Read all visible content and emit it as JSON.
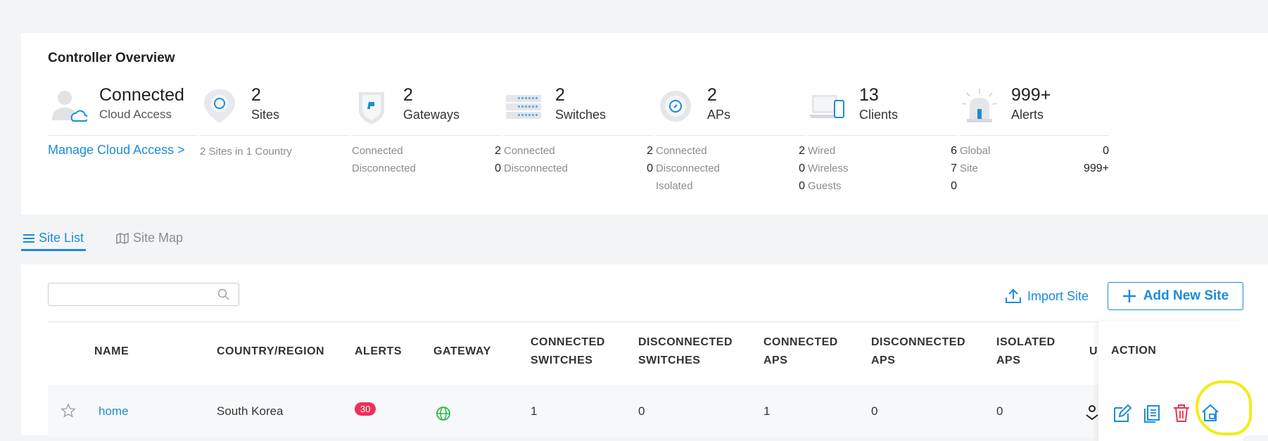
{
  "overview": {
    "title": "Controller Overview",
    "cloud": {
      "status": "Connected",
      "label": "Cloud Access",
      "link": "Manage Cloud Access >"
    },
    "sites": {
      "count": "2",
      "label": "Sites",
      "sub": "2 Sites in 1 Country"
    },
    "gateways": {
      "count": "2",
      "label": "Gateways",
      "rows": [
        {
          "k": "Connected",
          "v": "2"
        },
        {
          "k": "Disconnected",
          "v": "0"
        }
      ]
    },
    "switches": {
      "count": "2",
      "label": "Switches",
      "rows": [
        {
          "k": "Connected",
          "v": "2"
        },
        {
          "k": "Disconnected",
          "v": "0"
        }
      ]
    },
    "aps": {
      "count": "2",
      "label": "APs",
      "rows": [
        {
          "k": "Connected",
          "v": "2"
        },
        {
          "k": "Disconnected",
          "v": "0"
        },
        {
          "k": "Isolated",
          "v": "0"
        }
      ]
    },
    "clients": {
      "count": "13",
      "label": "Clients",
      "rows": [
        {
          "k": "Wired",
          "v": "6"
        },
        {
          "k": "Wireless",
          "v": "7"
        },
        {
          "k": "Guests",
          "v": "0"
        }
      ]
    },
    "alerts": {
      "count": "999+",
      "label": "Alerts",
      "rows": [
        {
          "k": "Global",
          "v": "0"
        },
        {
          "k": "Site",
          "v": "999+"
        }
      ]
    }
  },
  "tabs": {
    "site_list": "Site List",
    "site_map": "Site Map"
  },
  "toolbar": {
    "search_placeholder": "",
    "import_label": "Import Site",
    "add_label": "Add New Site"
  },
  "table": {
    "headers": {
      "name": "NAME",
      "country": "COUNTRY/REGION",
      "alerts": "ALERTS",
      "gateway": "GATEWAY",
      "connected_switches_1": "CONNECTED",
      "connected_switches_2": "SWITCHES",
      "disconnected_switches_1": "DISCONNECTED",
      "disconnected_switches_2": "SWITCHES",
      "connected_aps_1": "CONNECTED",
      "connected_aps_2": "APS",
      "disconnected_aps_1": "DISCONNECTED",
      "disconnected_aps_2": "APS",
      "isolated_aps_1": "ISOLATED",
      "isolated_aps_2": "APS",
      "truncated": "U",
      "action": "ACTION"
    },
    "rows": [
      {
        "name": "home",
        "country": "South Korea",
        "alerts": "30",
        "connected_switches": "1",
        "disconnected_switches": "0",
        "connected_aps": "1",
        "disconnected_aps": "0",
        "isolated_aps": "0"
      }
    ]
  },
  "colors": {
    "accent": "#1a8cd8",
    "alert_badge": "#ef2f58",
    "gateway_online": "#2db84d",
    "delete": "#e8334f",
    "highlight": "#f0ec1a"
  }
}
